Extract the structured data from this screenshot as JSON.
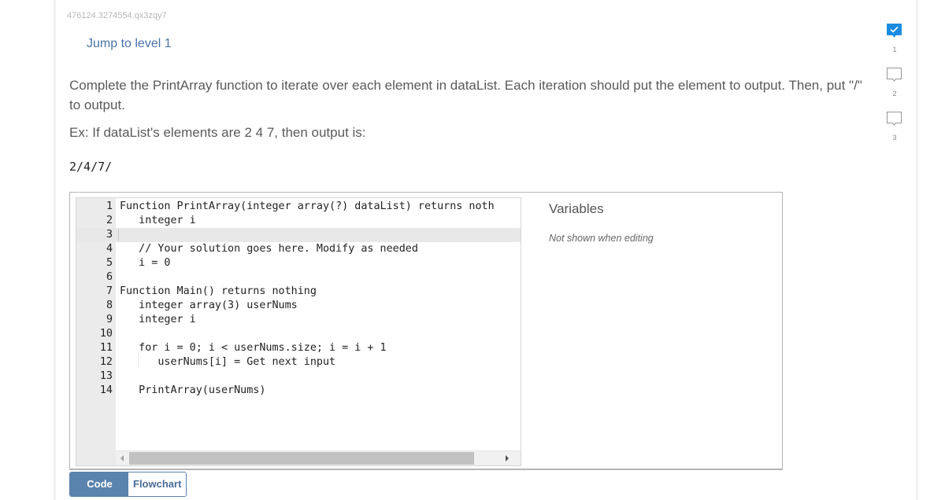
{
  "activity_id": "476124.3274554.qx3zqy7",
  "jump_link": "Jump to level 1",
  "prompt": {
    "text": "Complete the PrintArray function to iterate over each element in dataList. Each iteration should put the element to output. Then, put \"/\" to output.",
    "example": "Ex: If dataList's elements are 2 4 7, then output is:",
    "example_output": "2/4/7/"
  },
  "editor": {
    "active_line": 3,
    "lines": [
      {
        "n": "1",
        "text": "Function PrintArray(integer array(?) dataList) returns noth"
      },
      {
        "n": "2",
        "text": "   integer i"
      },
      {
        "n": "3",
        "text": ""
      },
      {
        "n": "4",
        "text": "   // Your solution goes here. Modify as needed"
      },
      {
        "n": "5",
        "text": "   i = 0"
      },
      {
        "n": "6",
        "text": ""
      },
      {
        "n": "7",
        "text": "Function Main() returns nothing"
      },
      {
        "n": "8",
        "text": "   integer array(3) userNums"
      },
      {
        "n": "9",
        "text": "   integer i"
      },
      {
        "n": "10",
        "text": ""
      },
      {
        "n": "11",
        "text": "   for i = 0; i < userNums.size; i = i + 1"
      },
      {
        "n": "12",
        "text": "      userNums[i] = Get next input"
      },
      {
        "n": "13",
        "text": ""
      },
      {
        "n": "14",
        "text": "   PrintArray(userNums)"
      }
    ]
  },
  "variables": {
    "title": "Variables",
    "note": "Not shown when editing"
  },
  "mode_tabs": {
    "code": "Code",
    "flowchart": "Flowchart",
    "active": "Code"
  },
  "levels": [
    {
      "number": "1",
      "completed": true
    },
    {
      "number": "2",
      "completed": false
    },
    {
      "number": "3",
      "completed": false
    }
  ],
  "colors": {
    "accent": "#5a83ad",
    "level_complete": "#1a8be0",
    "link": "#4a72a8"
  }
}
